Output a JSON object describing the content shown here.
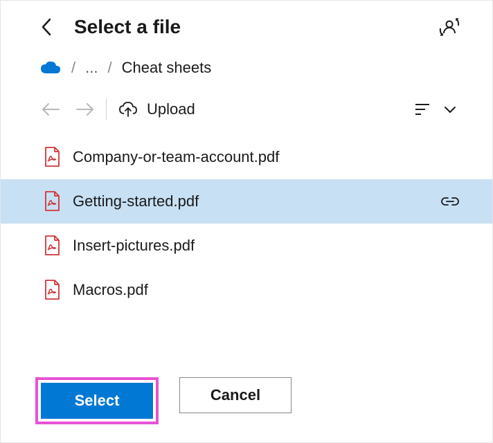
{
  "header": {
    "title": "Select a file"
  },
  "breadcrumb": {
    "ellipsis": "...",
    "current": "Cheat sheets"
  },
  "toolbar": {
    "upload_label": "Upload"
  },
  "files": [
    {
      "name": "Company-or-team-account.pdf",
      "selected": false,
      "linked": false
    },
    {
      "name": "Getting-started.pdf",
      "selected": true,
      "linked": true
    },
    {
      "name": "Insert-pictures.pdf",
      "selected": false,
      "linked": false
    },
    {
      "name": "Macros.pdf",
      "selected": false,
      "linked": false
    }
  ],
  "buttons": {
    "select": "Select",
    "cancel": "Cancel"
  },
  "colors": {
    "primary": "#0078d4",
    "highlight": "#e752d5",
    "selection": "#c7e0f4"
  }
}
